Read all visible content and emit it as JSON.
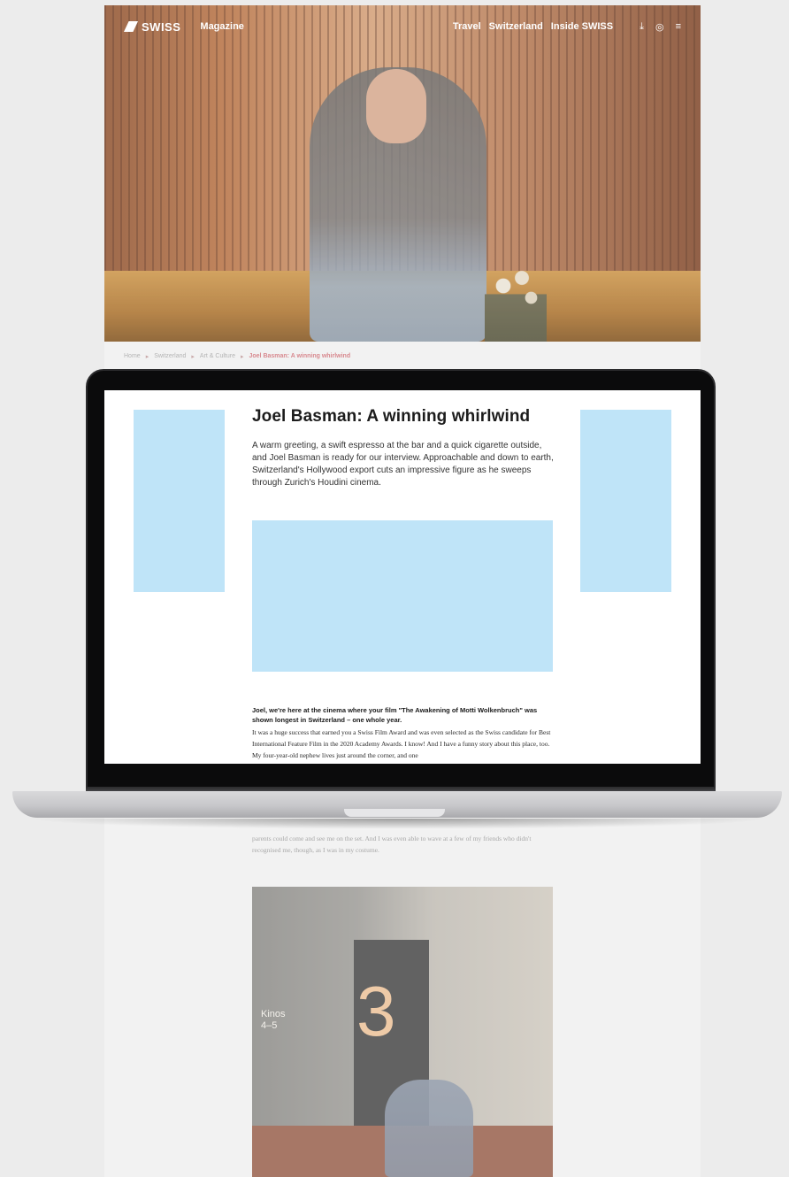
{
  "nav": {
    "brand": "SWISS",
    "magazine": "Magazine",
    "links": [
      "Travel",
      "Switzerland",
      "Inside SWISS"
    ],
    "icons": [
      "download-icon",
      "globe-icon",
      "menu-icon"
    ]
  },
  "breadcrumb": {
    "items": [
      "Home",
      "Switzerland",
      "Art & Culture"
    ],
    "current": "Joel Basman: A winning whirlwind"
  },
  "article": {
    "title": "Joel Basman: A winning whirlwind",
    "lead": "A warm greeting, a swift espresso at the bar and a quick cigarette outside, and Joel Basman is ready for our interview. Approachable and down to earth, Switzerland's Hollywood export cuts an impressive figure as he sweeps through Zurich's Houdini cinema.",
    "question": "Joel, we're here at the cinema where your film \"The Awakening of Motti Wolkenbruch\" was shown longest in Switzerland – one whole year.",
    "answer": "It was a huge success that earned you a Swiss Film Award and was even selected as the Swiss candidate for Best International Feature Film in the 2020 Academy Awards. I know! And I have a funny story about this place, too. My four-year-old nephew lives just around the corner, and one",
    "continued": "parents could come and see me on the set. And I was even able to wave at a few of my friends who didn't recognised me, though, as I was in my costume."
  },
  "photo": {
    "door_number": "3",
    "sign_line1": "Kinos",
    "sign_line2": "4–5"
  },
  "colors": {
    "ad_placeholder": "#bfe4f8",
    "breadcrumb_current": "#d8898f"
  }
}
